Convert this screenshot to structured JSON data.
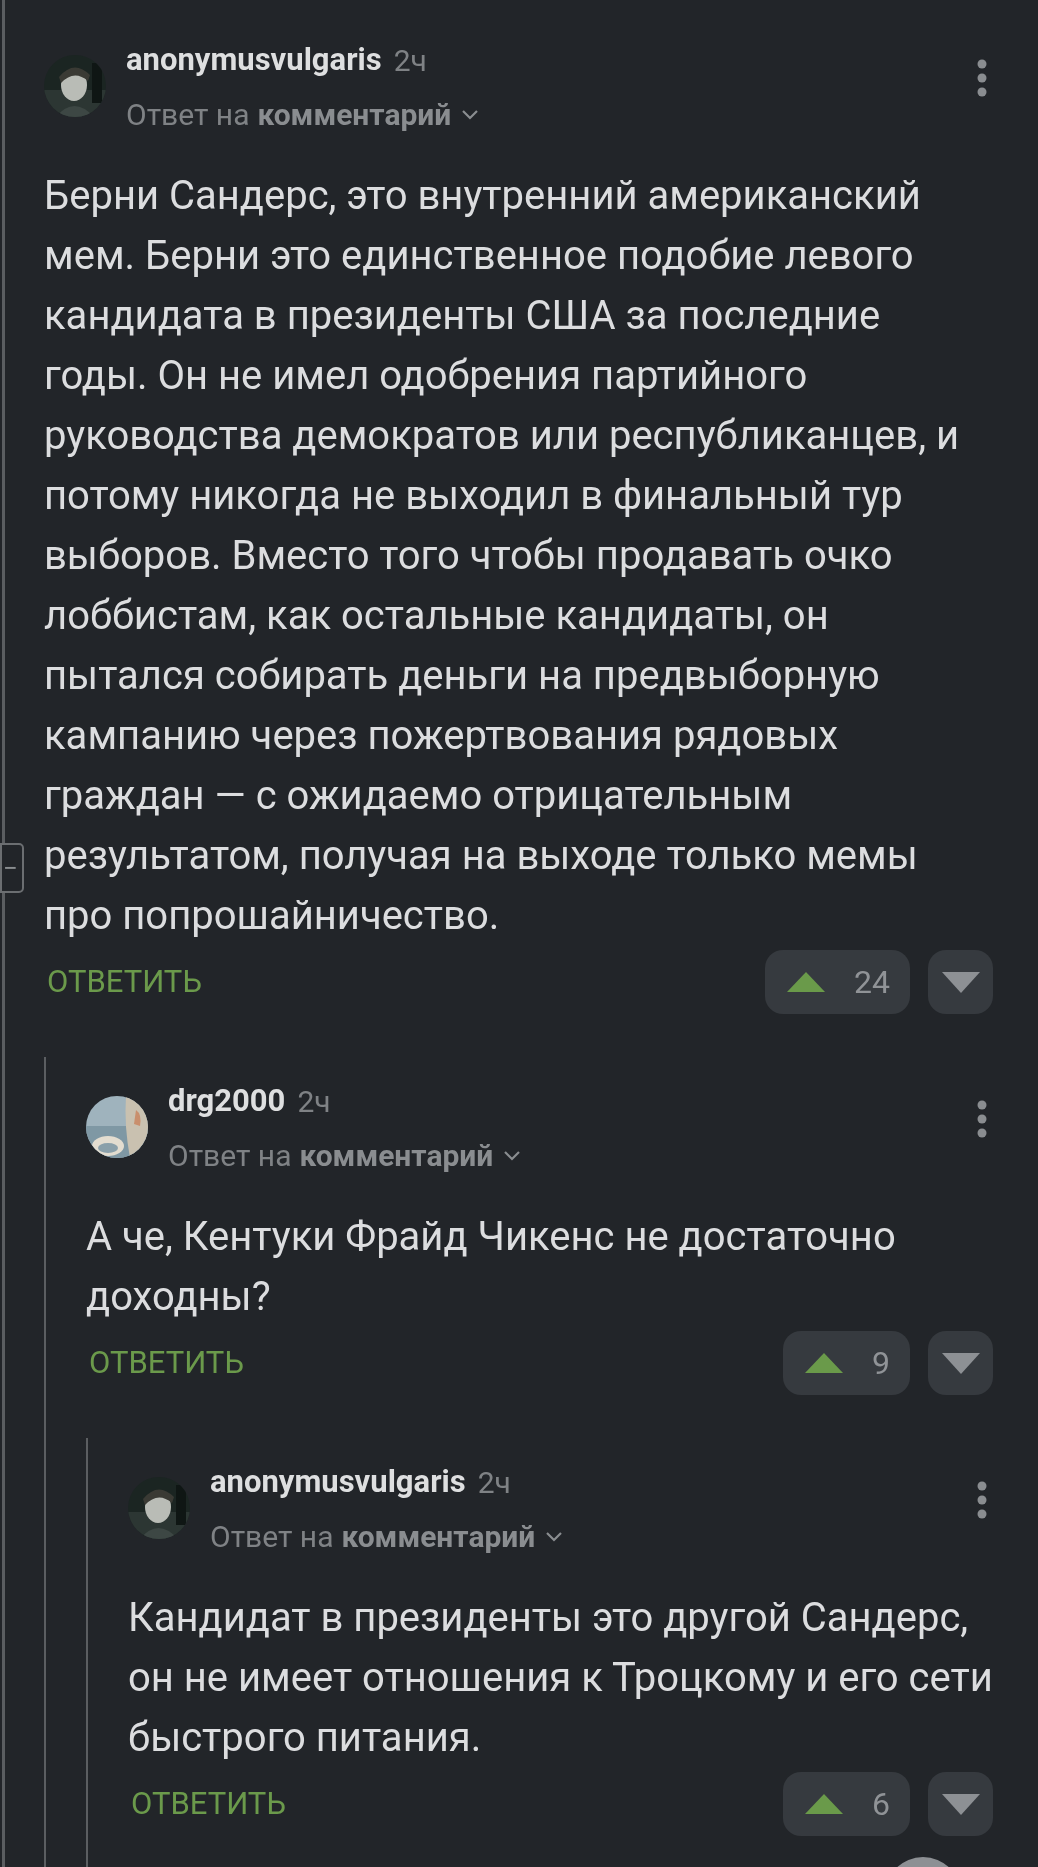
{
  "thread": [
    {
      "author": "anonymusvulgaris",
      "time": "2ч",
      "reply_prefix": "Ответ на",
      "reply_target": "комментарий",
      "text": "Берни Сандерс, это внутренний американский мем. Берни это единственное подобие левого кандидата в президенты США за последние годы. Он не имел одобрения партийного руководства демократов или республиканцев, и потому никогда не выходил в финальный тур выборов. Вместо того чтобы продавать очко лоббистам, как остальные кандидаты, он пытался собирать деньги на предвыборную кампанию через пожертвования рядовых граждан — с ожидаемо отрицательным результатом, получая на выходе только мемы про попрошайничество.",
      "reply_button": "ОТВЕТИТЬ",
      "votes": "24",
      "collapse_button": "−",
      "children": [
        {
          "author": "drg2000",
          "time": "2ч",
          "reply_prefix": "Ответ на",
          "reply_target": "комментарий",
          "text": "А че, Кентуки Фрайд Чикенс не достаточно доходны?",
          "reply_button": "ОТВЕТИТЬ",
          "votes": "9",
          "children": [
            {
              "author": "anonymusvulgaris",
              "time": "2ч",
              "reply_prefix": "Ответ на",
              "reply_target": "комментарий",
              "text": "Кандидат в президенты это другой Сандерс, он не имеет отношения к Троцкому и его сети быстрого питания.",
              "reply_button": "ОТВЕТИТЬ",
              "votes": "6"
            }
          ]
        }
      ]
    }
  ]
}
